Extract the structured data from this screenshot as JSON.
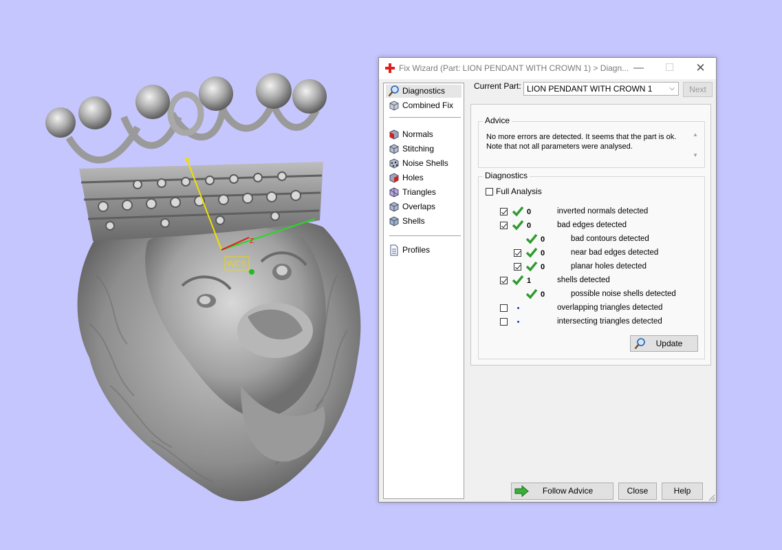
{
  "viewport": {
    "model": "lion pendant with crown 3D mesh",
    "wcs_label": "WCS",
    "axis_z_label": "Z",
    "background_color": "#c6c6fe"
  },
  "dialog": {
    "title": "Fix Wizard (Part: LION PENDANT WITH CROWN 1) > Diagn...",
    "window_buttons": {
      "minimize": "—",
      "maximize": "☐",
      "close": "✕"
    }
  },
  "nav": {
    "items": [
      {
        "label": "Diagnostics",
        "icon": "magnifier-icon",
        "selected": true
      },
      {
        "label": "Combined Fix",
        "icon": "cube-icon"
      },
      {
        "label": "Normals",
        "icon": "normals-cube-icon"
      },
      {
        "label": "Stitching",
        "icon": "stitching-cube-icon"
      },
      {
        "label": "Noise Shells",
        "icon": "noise-cube-icon"
      },
      {
        "label": "Holes",
        "icon": "holes-cube-icon"
      },
      {
        "label": "Triangles",
        "icon": "triangles-cube-icon"
      },
      {
        "label": "Overlaps",
        "icon": "overlaps-cube-icon"
      },
      {
        "label": "Shells",
        "icon": "shells-cube-icon"
      },
      {
        "label": "Profiles",
        "icon": "document-icon"
      }
    ]
  },
  "current_part": {
    "label": "Current Part:",
    "value": "LION PENDANT WITH CROWN 1",
    "next_label": "Next"
  },
  "advice": {
    "title": "Advice",
    "line1": "No more errors are detected. It seems that the part is ok.",
    "line2": "Note that not all parameters were analysed."
  },
  "diagnostics": {
    "title": "Diagnostics",
    "full_analysis_label": "Full Analysis",
    "rows": [
      {
        "checked": true,
        "status": "ok",
        "count": "0",
        "text": "inverted normals detected"
      },
      {
        "checked": true,
        "status": "ok",
        "count": "0",
        "text": "bad edges detected"
      },
      {
        "checkbox": false,
        "status": "ok",
        "count": "0",
        "text": "bad contours detected"
      },
      {
        "checked": true,
        "status": "ok",
        "count": "0",
        "text": "near bad edges detected"
      },
      {
        "checked": true,
        "status": "ok",
        "count": "0",
        "text": "planar holes detected"
      },
      {
        "checked": true,
        "status": "ok",
        "count": "1",
        "text": "shells detected"
      },
      {
        "checkbox": false,
        "status": "ok",
        "count": "0",
        "text": "possible noise shells detected"
      },
      {
        "checked": false,
        "status": "none",
        "count": "",
        "text": "overlapping triangles detected"
      },
      {
        "checked": false,
        "status": "none",
        "count": "",
        "text": "intersecting triangles detected"
      }
    ],
    "update_label": "Update"
  },
  "buttons": {
    "follow_advice": "Follow Advice",
    "close": "Close",
    "help": "Help"
  },
  "colors": {
    "tick_green": "#2e9a2e",
    "arrow_green": "#36b236",
    "accent_red": "#e02020"
  }
}
